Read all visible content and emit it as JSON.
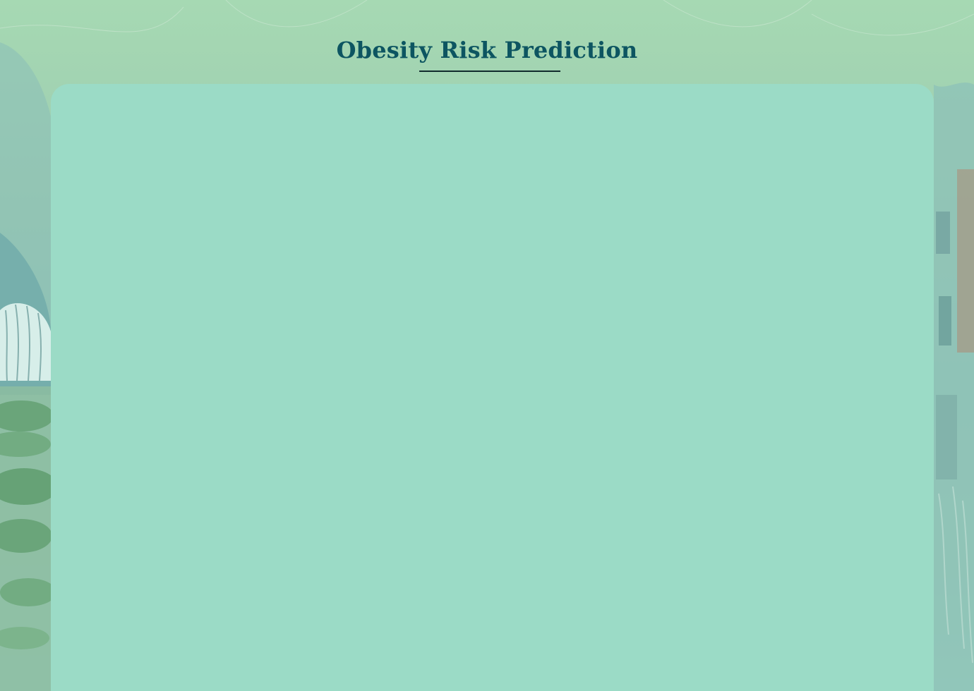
{
  "page": {
    "title": "Obesity Risk Prediction"
  },
  "theme": {
    "title_color": "#0d5561",
    "panel_color": "#9bdbc6",
    "underline_color": "#112a2c",
    "background_top": "#a6d9b3",
    "background_bottom": "#98d6c6"
  }
}
